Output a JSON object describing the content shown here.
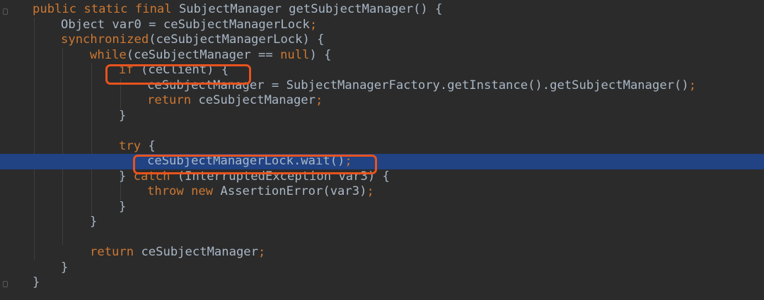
{
  "editor": {
    "lines": [
      {
        "tokens": [
          {
            "t": "public static final",
            "k": "kw"
          },
          {
            "t": " SubjectManager getSubjectManager() {",
            "k": "plain"
          }
        ]
      },
      {
        "tokens": [
          {
            "t": "Object var0 = ceSubjectManagerLock",
            "k": "plain"
          },
          {
            "t": ";",
            "k": "kw"
          }
        ]
      },
      {
        "tokens": [
          {
            "t": "synchronized",
            "k": "kw"
          },
          {
            "t": "(ceSubjectManagerLock) {",
            "k": "plain"
          }
        ]
      },
      {
        "tokens": [
          {
            "t": "while",
            "k": "kw"
          },
          {
            "t": "(ceSubjectManager == ",
            "k": "plain"
          },
          {
            "t": "null",
            "k": "kw"
          },
          {
            "t": ") {",
            "k": "plain"
          }
        ]
      },
      {
        "tokens": [
          {
            "t": "if",
            "k": "kw"
          },
          {
            "t": " (ceClient) {",
            "k": "plain"
          }
        ]
      },
      {
        "tokens": [
          {
            "t": "ceSubjectManager = SubjectManagerFactory.getInstance().getSubjectManager()",
            "k": "plain"
          },
          {
            "t": ";",
            "k": "kw"
          }
        ]
      },
      {
        "tokens": [
          {
            "t": "return",
            "k": "kw"
          },
          {
            "t": " ceSubjectManager",
            "k": "plain"
          },
          {
            "t": ";",
            "k": "kw"
          }
        ]
      },
      {
        "tokens": [
          {
            "t": "}",
            "k": "plain"
          }
        ]
      },
      {
        "tokens": []
      },
      {
        "tokens": [
          {
            "t": "try",
            "k": "kw"
          },
          {
            "t": " {",
            "k": "plain"
          }
        ]
      },
      {
        "tokens": [
          {
            "t": "ceSubjectManagerLock.wait()",
            "k": "plain"
          },
          {
            "t": ";",
            "k": "kw"
          }
        ]
      },
      {
        "tokens": [
          {
            "t": "} ",
            "k": "plain"
          },
          {
            "t": "catch",
            "k": "kw"
          },
          {
            "t": " (InterruptedException var3) {",
            "k": "plain"
          }
        ]
      },
      {
        "tokens": [
          {
            "t": "throw new",
            "k": "kw"
          },
          {
            "t": " AssertionError(var3)",
            "k": "plain"
          },
          {
            "t": ";",
            "k": "kw"
          }
        ]
      },
      {
        "tokens": [
          {
            "t": "}",
            "k": "plain"
          }
        ]
      },
      {
        "tokens": [
          {
            "t": "}",
            "k": "plain"
          }
        ]
      },
      {
        "tokens": []
      },
      {
        "tokens": [
          {
            "t": "return",
            "k": "kw"
          },
          {
            "t": " ceSubjectManager",
            "k": "plain"
          },
          {
            "t": ";",
            "k": "kw"
          }
        ]
      },
      {
        "tokens": [
          {
            "t": "}",
            "k": "plain"
          }
        ]
      },
      {
        "tokens": [
          {
            "t": "}",
            "k": "plain"
          }
        ]
      }
    ],
    "current_line_index": 10,
    "highlighted_line_indices": [
      4,
      10
    ]
  },
  "colors": {
    "background": "#2b2b2b",
    "plain_text": "#a9b7c6",
    "keyword": "#cc7832",
    "current_line": "#214283",
    "annotation_box": "#e8531d"
  }
}
